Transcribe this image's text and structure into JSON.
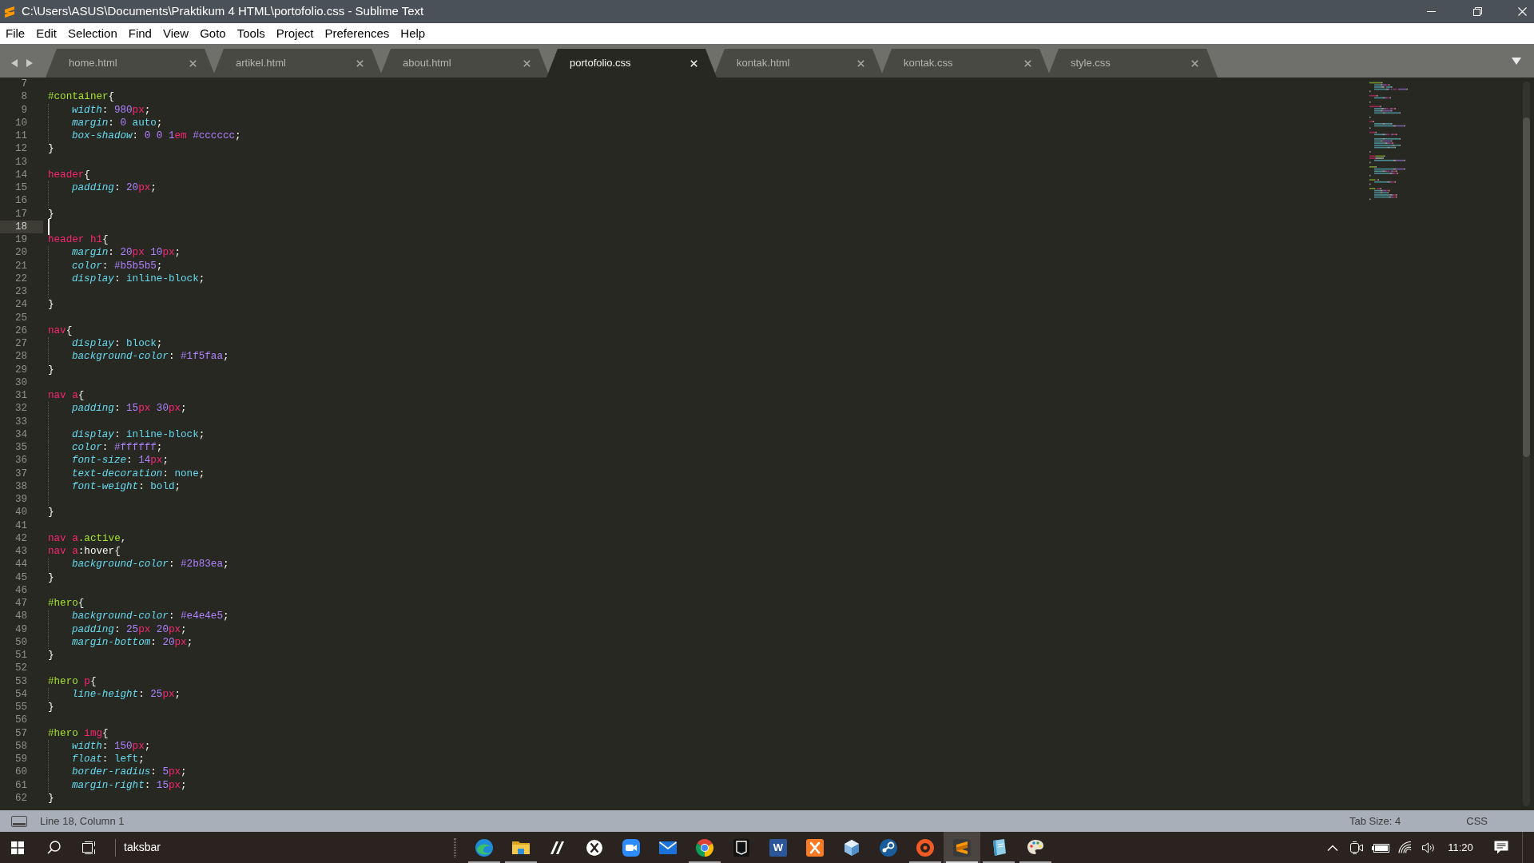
{
  "window": {
    "title": "C:\\Users\\ASUS\\Documents\\Praktikum 4 HTML\\portofolio.css - Sublime Text"
  },
  "menu": [
    "File",
    "Edit",
    "Selection",
    "Find",
    "View",
    "Goto",
    "Tools",
    "Project",
    "Preferences",
    "Help"
  ],
  "tabs": [
    {
      "label": "home.html",
      "selected": false
    },
    {
      "label": "artikel.html",
      "selected": false
    },
    {
      "label": "about.html",
      "selected": false
    },
    {
      "label": "portofolio.css",
      "selected": true
    },
    {
      "label": "kontak.html",
      "selected": false
    },
    {
      "label": "kontak.css",
      "selected": false
    },
    {
      "label": "style.css",
      "selected": false
    }
  ],
  "editor": {
    "lines": [
      {
        "number": "7",
        "indented": false,
        "current": false
      },
      {
        "number": "8",
        "indented": false,
        "current": false,
        "tokens": [
          {
            "kind": "id",
            "text": "#container"
          },
          {
            "kind": "punct",
            "text": "{"
          }
        ]
      },
      {
        "number": "9",
        "indented": true,
        "current": false,
        "tokens": [
          {
            "kind": "prop",
            "text": "width"
          },
          {
            "kind": "punct",
            "text": ": "
          },
          {
            "kind": "num",
            "text": "980"
          },
          {
            "kind": "unit",
            "text": "px"
          },
          {
            "kind": "punct",
            "text": ";"
          }
        ]
      },
      {
        "number": "10",
        "indented": true,
        "current": false,
        "tokens": [
          {
            "kind": "prop",
            "text": "margin"
          },
          {
            "kind": "punct",
            "text": ": "
          },
          {
            "kind": "num",
            "text": "0"
          },
          {
            "kind": "kw",
            "text": " auto"
          },
          {
            "kind": "punct",
            "text": ";"
          }
        ]
      },
      {
        "number": "11",
        "indented": true,
        "current": false,
        "tokens": [
          {
            "kind": "prop",
            "text": "box-shadow"
          },
          {
            "kind": "punct",
            "text": ": "
          },
          {
            "kind": "num",
            "text": "0"
          },
          {
            "kind": "num",
            "text": " 0"
          },
          {
            "kind": "num",
            "text": " 1"
          },
          {
            "kind": "unit",
            "text": "em"
          },
          {
            "kind": "hex",
            "text": " #cccccc"
          },
          {
            "kind": "punct",
            "text": ";"
          }
        ]
      },
      {
        "number": "12",
        "indented": false,
        "current": false,
        "tokens": [
          {
            "kind": "punct",
            "text": "}"
          }
        ]
      },
      {
        "number": "13",
        "indented": false,
        "current": false
      },
      {
        "number": "14",
        "indented": false,
        "current": false,
        "tokens": [
          {
            "kind": "tag",
            "text": "header"
          },
          {
            "kind": "punct",
            "text": "{"
          }
        ]
      },
      {
        "number": "15",
        "indented": true,
        "current": false,
        "tokens": [
          {
            "kind": "prop",
            "text": "padding"
          },
          {
            "kind": "punct",
            "text": ": "
          },
          {
            "kind": "num",
            "text": "20"
          },
          {
            "kind": "unit",
            "text": "px"
          },
          {
            "kind": "punct",
            "text": ";"
          }
        ]
      },
      {
        "number": "16",
        "indented": true,
        "current": false
      },
      {
        "number": "17",
        "indented": false,
        "current": false,
        "tokens": [
          {
            "kind": "punct",
            "text": "}"
          }
        ]
      },
      {
        "number": "18",
        "indented": false,
        "current": true
      },
      {
        "number": "19",
        "indented": false,
        "current": false,
        "tokens": [
          {
            "kind": "tag",
            "text": "header h1"
          },
          {
            "kind": "punct",
            "text": "{"
          }
        ]
      },
      {
        "number": "20",
        "indented": true,
        "current": false,
        "tokens": [
          {
            "kind": "prop",
            "text": "margin"
          },
          {
            "kind": "punct",
            "text": ": "
          },
          {
            "kind": "num",
            "text": "20"
          },
          {
            "kind": "unit",
            "text": "px"
          },
          {
            "kind": "num",
            "text": " 10"
          },
          {
            "kind": "unit",
            "text": "px"
          },
          {
            "kind": "punct",
            "text": ";"
          }
        ]
      },
      {
        "number": "21",
        "indented": true,
        "current": false,
        "tokens": [
          {
            "kind": "prop",
            "text": "color"
          },
          {
            "kind": "punct",
            "text": ": "
          },
          {
            "kind": "hex",
            "text": "#b5b5b5"
          },
          {
            "kind": "punct",
            "text": ";"
          }
        ]
      },
      {
        "number": "22",
        "indented": true,
        "current": false,
        "tokens": [
          {
            "kind": "prop",
            "text": "display"
          },
          {
            "kind": "punct",
            "text": ": "
          },
          {
            "kind": "kw",
            "text": "inline-block"
          },
          {
            "kind": "punct",
            "text": ";"
          }
        ]
      },
      {
        "number": "23",
        "indented": true,
        "current": false
      },
      {
        "number": "24",
        "indented": false,
        "current": false,
        "tokens": [
          {
            "kind": "punct",
            "text": "}"
          }
        ]
      },
      {
        "number": "25",
        "indented": false,
        "current": false
      },
      {
        "number": "26",
        "indented": false,
        "current": false,
        "tokens": [
          {
            "kind": "tag",
            "text": "nav"
          },
          {
            "kind": "punct",
            "text": "{"
          }
        ]
      },
      {
        "number": "27",
        "indented": true,
        "current": false,
        "tokens": [
          {
            "kind": "prop",
            "text": "display"
          },
          {
            "kind": "punct",
            "text": ": "
          },
          {
            "kind": "kw",
            "text": "block"
          },
          {
            "kind": "punct",
            "text": ";"
          }
        ]
      },
      {
        "number": "28",
        "indented": true,
        "current": false,
        "tokens": [
          {
            "kind": "prop",
            "text": "background-color"
          },
          {
            "kind": "punct",
            "text": ": "
          },
          {
            "kind": "hex",
            "text": "#1f5faa"
          },
          {
            "kind": "punct",
            "text": ";"
          }
        ]
      },
      {
        "number": "29",
        "indented": false,
        "current": false,
        "tokens": [
          {
            "kind": "punct",
            "text": "}"
          }
        ]
      },
      {
        "number": "30",
        "indented": false,
        "current": false
      },
      {
        "number": "31",
        "indented": false,
        "current": false,
        "tokens": [
          {
            "kind": "tag",
            "text": "nav a"
          },
          {
            "kind": "punct",
            "text": "{"
          }
        ]
      },
      {
        "number": "32",
        "indented": true,
        "current": false,
        "tokens": [
          {
            "kind": "prop",
            "text": "padding"
          },
          {
            "kind": "punct",
            "text": ": "
          },
          {
            "kind": "num",
            "text": "15"
          },
          {
            "kind": "unit",
            "text": "px"
          },
          {
            "kind": "num",
            "text": " 30"
          },
          {
            "kind": "unit",
            "text": "px"
          },
          {
            "kind": "punct",
            "text": ";"
          }
        ]
      },
      {
        "number": "33",
        "indented": true,
        "current": false
      },
      {
        "number": "34",
        "indented": true,
        "current": false,
        "tokens": [
          {
            "kind": "prop",
            "text": "display"
          },
          {
            "kind": "punct",
            "text": ": "
          },
          {
            "kind": "kw",
            "text": "inline-block"
          },
          {
            "kind": "punct",
            "text": ";"
          }
        ]
      },
      {
        "number": "35",
        "indented": true,
        "current": false,
        "tokens": [
          {
            "kind": "prop",
            "text": "color"
          },
          {
            "kind": "punct",
            "text": ": "
          },
          {
            "kind": "hex",
            "text": "#ffffff"
          },
          {
            "kind": "punct",
            "text": ";"
          }
        ]
      },
      {
        "number": "36",
        "indented": true,
        "current": false,
        "tokens": [
          {
            "kind": "prop",
            "text": "font-size"
          },
          {
            "kind": "punct",
            "text": ": "
          },
          {
            "kind": "num",
            "text": "14"
          },
          {
            "kind": "unit",
            "text": "px"
          },
          {
            "kind": "punct",
            "text": ";"
          }
        ]
      },
      {
        "number": "37",
        "indented": true,
        "current": false,
        "tokens": [
          {
            "kind": "prop",
            "text": "text-decoration"
          },
          {
            "kind": "punct",
            "text": ": "
          },
          {
            "kind": "kw",
            "text": "none"
          },
          {
            "kind": "punct",
            "text": ";"
          }
        ]
      },
      {
        "number": "38",
        "indented": true,
        "current": false,
        "tokens": [
          {
            "kind": "prop",
            "text": "font-weight"
          },
          {
            "kind": "punct",
            "text": ": "
          },
          {
            "kind": "kw",
            "text": "bold"
          },
          {
            "kind": "punct",
            "text": ";"
          }
        ]
      },
      {
        "number": "39",
        "indented": true,
        "current": false
      },
      {
        "number": "40",
        "indented": false,
        "current": false,
        "tokens": [
          {
            "kind": "punct",
            "text": "}"
          }
        ]
      },
      {
        "number": "41",
        "indented": false,
        "current": false
      },
      {
        "number": "42",
        "indented": false,
        "current": false,
        "tokens": [
          {
            "kind": "tag",
            "text": "nav a"
          },
          {
            "kind": "cls",
            "text": ".active"
          },
          {
            "kind": "punct",
            "text": ","
          }
        ]
      },
      {
        "number": "43",
        "indented": false,
        "current": false,
        "tokens": [
          {
            "kind": "tag",
            "text": "nav a"
          },
          {
            "kind": "pseudo",
            "text": ":hover"
          },
          {
            "kind": "punct",
            "text": "{"
          }
        ]
      },
      {
        "number": "44",
        "indented": true,
        "current": false,
        "tokens": [
          {
            "kind": "prop",
            "text": "background-color"
          },
          {
            "kind": "punct",
            "text": ": "
          },
          {
            "kind": "hex",
            "text": "#2b83ea"
          },
          {
            "kind": "punct",
            "text": ";"
          }
        ]
      },
      {
        "number": "45",
        "indented": false,
        "current": false,
        "tokens": [
          {
            "kind": "punct",
            "text": "}"
          }
        ]
      },
      {
        "number": "46",
        "indented": false,
        "current": false
      },
      {
        "number": "47",
        "indented": false,
        "current": false,
        "tokens": [
          {
            "kind": "id",
            "text": "#hero"
          },
          {
            "kind": "punct",
            "text": "{"
          }
        ]
      },
      {
        "number": "48",
        "indented": true,
        "current": false,
        "tokens": [
          {
            "kind": "prop",
            "text": "background-color"
          },
          {
            "kind": "punct",
            "text": ": "
          },
          {
            "kind": "hex",
            "text": "#e4e4e5"
          },
          {
            "kind": "punct",
            "text": ";"
          }
        ]
      },
      {
        "number": "49",
        "indented": true,
        "current": false,
        "tokens": [
          {
            "kind": "prop",
            "text": "padding"
          },
          {
            "kind": "punct",
            "text": ": "
          },
          {
            "kind": "num",
            "text": "25"
          },
          {
            "kind": "unit",
            "text": "px"
          },
          {
            "kind": "num",
            "text": " 20"
          },
          {
            "kind": "unit",
            "text": "px"
          },
          {
            "kind": "punct",
            "text": ";"
          }
        ]
      },
      {
        "number": "50",
        "indented": true,
        "current": false,
        "tokens": [
          {
            "kind": "prop",
            "text": "margin-bottom"
          },
          {
            "kind": "punct",
            "text": ": "
          },
          {
            "kind": "num",
            "text": "20"
          },
          {
            "kind": "unit",
            "text": "px"
          },
          {
            "kind": "punct",
            "text": ";"
          }
        ]
      },
      {
        "number": "51",
        "indented": false,
        "current": false,
        "tokens": [
          {
            "kind": "punct",
            "text": "}"
          }
        ]
      },
      {
        "number": "52",
        "indented": false,
        "current": false
      },
      {
        "number": "53",
        "indented": false,
        "current": false,
        "tokens": [
          {
            "kind": "id",
            "text": "#hero"
          },
          {
            "kind": "tag",
            "text": " p"
          },
          {
            "kind": "punct",
            "text": "{"
          }
        ]
      },
      {
        "number": "54",
        "indented": true,
        "current": false,
        "tokens": [
          {
            "kind": "prop",
            "text": "line-height"
          },
          {
            "kind": "punct",
            "text": ": "
          },
          {
            "kind": "num",
            "text": "25"
          },
          {
            "kind": "unit",
            "text": "px"
          },
          {
            "kind": "punct",
            "text": ";"
          }
        ]
      },
      {
        "number": "55",
        "indented": false,
        "current": false,
        "tokens": [
          {
            "kind": "punct",
            "text": "}"
          }
        ]
      },
      {
        "number": "56",
        "indented": false,
        "current": false
      },
      {
        "number": "57",
        "indented": false,
        "current": false,
        "tokens": [
          {
            "kind": "id",
            "text": "#hero"
          },
          {
            "kind": "tag",
            "text": " img"
          },
          {
            "kind": "punct",
            "text": "{"
          }
        ]
      },
      {
        "number": "58",
        "indented": true,
        "current": false,
        "tokens": [
          {
            "kind": "prop",
            "text": "width"
          },
          {
            "kind": "punct",
            "text": ": "
          },
          {
            "kind": "num",
            "text": "150"
          },
          {
            "kind": "unit",
            "text": "px"
          },
          {
            "kind": "punct",
            "text": ";"
          }
        ]
      },
      {
        "number": "59",
        "indented": true,
        "current": false,
        "tokens": [
          {
            "kind": "prop",
            "text": "float"
          },
          {
            "kind": "punct",
            "text": ": "
          },
          {
            "kind": "kw",
            "text": "left"
          },
          {
            "kind": "punct",
            "text": ";"
          }
        ]
      },
      {
        "number": "60",
        "indented": true,
        "current": false,
        "tokens": [
          {
            "kind": "prop",
            "text": "border-radius"
          },
          {
            "kind": "punct",
            "text": ": "
          },
          {
            "kind": "num",
            "text": "5"
          },
          {
            "kind": "unit",
            "text": "px"
          },
          {
            "kind": "punct",
            "text": ";"
          }
        ]
      },
      {
        "number": "61",
        "indented": true,
        "current": false,
        "tokens": [
          {
            "kind": "prop",
            "text": "margin-right"
          },
          {
            "kind": "punct",
            "text": ": "
          },
          {
            "kind": "num",
            "text": "15"
          },
          {
            "kind": "unit",
            "text": "px"
          },
          {
            "kind": "punct",
            "text": ";"
          }
        ]
      },
      {
        "number": "62",
        "indented": false,
        "current": false,
        "tokens": [
          {
            "kind": "punct",
            "text": "}"
          }
        ]
      }
    ]
  },
  "status_bar": {
    "position": "Line 18, Column 1",
    "tab_size": "Tab Size: 4",
    "syntax": "CSS"
  },
  "taskbar": {
    "toolbar_label": "taksbar",
    "apps": [
      {
        "kind": "swirl",
        "running": true,
        "selected": false
      },
      {
        "kind": "folder",
        "running": true,
        "selected": false
      },
      {
        "kind": "slashes",
        "running": false,
        "selected": false
      },
      {
        "kind": "x-circle",
        "running": false,
        "selected": false
      },
      {
        "kind": "video-camera",
        "running": false,
        "selected": false
      },
      {
        "kind": "envelope",
        "running": false,
        "selected": false
      },
      {
        "kind": "tricolor-circle",
        "running": true,
        "selected": false
      },
      {
        "kind": "shield",
        "running": false,
        "selected": false
      },
      {
        "kind": "letter-tile",
        "glyph": "W",
        "running": false,
        "selected": false
      },
      {
        "kind": "cross-tile",
        "running": false,
        "selected": false
      },
      {
        "kind": "cube",
        "running": false,
        "selected": false
      },
      {
        "kind": "key-circle",
        "running": false,
        "selected": false
      },
      {
        "kind": "ring",
        "running": true,
        "selected": false
      },
      {
        "kind": "stripes",
        "running": true,
        "selected": true
      },
      {
        "kind": "notebook",
        "running": true,
        "selected": false
      },
      {
        "kind": "palette",
        "running": true,
        "selected": false
      }
    ],
    "clock": "11:20"
  }
}
